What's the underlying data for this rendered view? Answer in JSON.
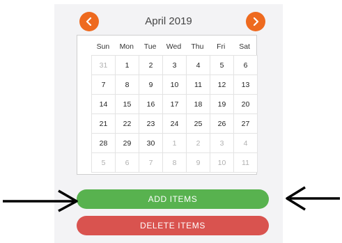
{
  "calendar": {
    "month_title": "April 2019",
    "weekdays": [
      "Sun",
      "Mon",
      "Tue",
      "Wed",
      "Thu",
      "Fri",
      "Sat"
    ],
    "weeks": [
      [
        {
          "d": "31",
          "muted": true
        },
        {
          "d": "1"
        },
        {
          "d": "2"
        },
        {
          "d": "3"
        },
        {
          "d": "4"
        },
        {
          "d": "5"
        },
        {
          "d": "6"
        }
      ],
      [
        {
          "d": "7"
        },
        {
          "d": "8"
        },
        {
          "d": "9"
        },
        {
          "d": "10"
        },
        {
          "d": "11"
        },
        {
          "d": "12"
        },
        {
          "d": "13"
        }
      ],
      [
        {
          "d": "14"
        },
        {
          "d": "15"
        },
        {
          "d": "16"
        },
        {
          "d": "17"
        },
        {
          "d": "18"
        },
        {
          "d": "19"
        },
        {
          "d": "20"
        }
      ],
      [
        {
          "d": "21"
        },
        {
          "d": "22"
        },
        {
          "d": "23"
        },
        {
          "d": "24"
        },
        {
          "d": "25"
        },
        {
          "d": "26"
        },
        {
          "d": "27"
        }
      ],
      [
        {
          "d": "28"
        },
        {
          "d": "29"
        },
        {
          "d": "30"
        },
        {
          "d": "1",
          "muted": true
        },
        {
          "d": "2",
          "muted": true
        },
        {
          "d": "3",
          "muted": true
        },
        {
          "d": "4",
          "muted": true
        }
      ],
      [
        {
          "d": "5",
          "muted": true
        },
        {
          "d": "6",
          "muted": true
        },
        {
          "d": "7",
          "muted": true
        },
        {
          "d": "8",
          "muted": true
        },
        {
          "d": "9",
          "muted": true
        },
        {
          "d": "10",
          "muted": true
        },
        {
          "d": "11",
          "muted": true
        }
      ]
    ]
  },
  "nav": {
    "prev_icon": "chevron-left-icon",
    "next_icon": "chevron-right-icon"
  },
  "actions": {
    "add_label": "ADD ITEMS",
    "delete_label": "DELETE ITEMS"
  },
  "colors": {
    "nav_accent": "#ee6a1f",
    "add_button": "#58b24f",
    "delete_button": "#d9534f"
  },
  "annotations": {
    "icons": [
      "arrow-right-icon",
      "arrow-left-icon"
    ]
  }
}
